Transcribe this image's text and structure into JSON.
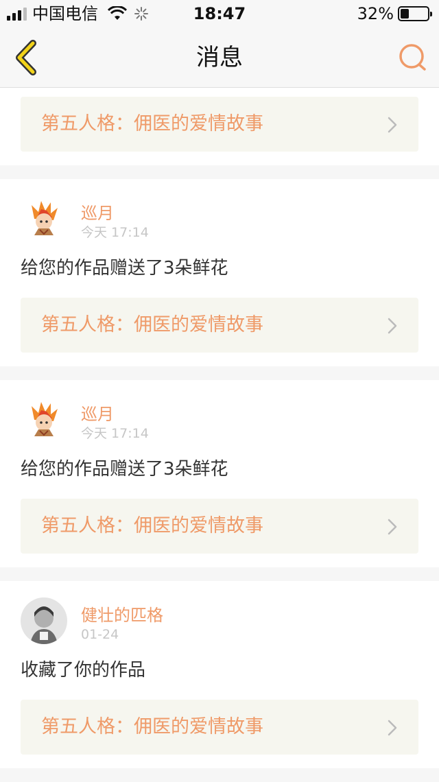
{
  "status_bar": {
    "carrier": "中国电信",
    "time": "18:47",
    "battery": "32%",
    "battery_level": 0.32
  },
  "nav": {
    "title": "消息",
    "back_icon": "chevron-left-icon",
    "search_icon": "search-icon"
  },
  "colors": {
    "accent": "#ef9a68",
    "link_bg": "#f6f6ef",
    "back_arrow": "#f2d31a"
  },
  "messages": [
    {
      "work_title": "第五人格：佣医的爱情故事"
    },
    {
      "user": "巡月",
      "time": "今天 17:14",
      "text": "给您的作品赠送了3朵鲜花",
      "work_title": "第五人格：佣医的爱情故事"
    },
    {
      "user": "巡月",
      "time": "今天 17:14",
      "text": "给您的作品赠送了3朵鲜花",
      "work_title": "第五人格：佣医的爱情故事"
    },
    {
      "user": "健壮的匹格",
      "time": "01-24",
      "text": "收藏了你的作品",
      "work_title": "第五人格：佣医的爱情故事"
    }
  ]
}
